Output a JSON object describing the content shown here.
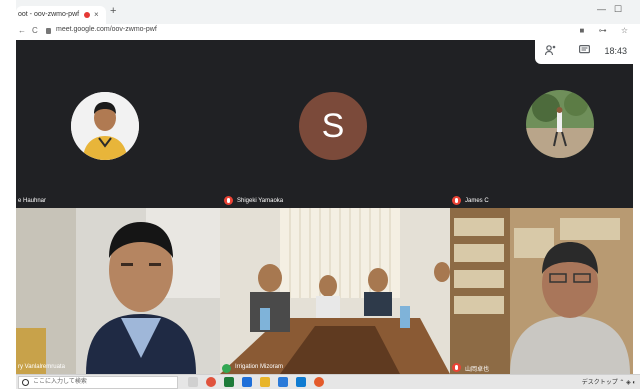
{
  "browser": {
    "tab_title": "oot - oov-zwmo-pwf",
    "url": "meet.google.com/oov-zwmo-pwf",
    "new_tab_glyph": "+",
    "close_glyph": "×",
    "back_glyph": "←",
    "forward_glyph": "→",
    "reload_glyph": "C"
  },
  "meet": {
    "time": "18:43",
    "people_icon": "people-icon",
    "chat_icon": "chat-icon",
    "participants": [
      {
        "name": "e Hauhnar",
        "type": "photo"
      },
      {
        "name": "Shigeki Yamaoka",
        "initial": "S",
        "type": "initial",
        "muted": true
      },
      {
        "name": "James C",
        "type": "photo",
        "muted": true
      },
      {
        "name": "ry Vanlalremruata",
        "type": "video"
      },
      {
        "name": "Irrigation Mizoram",
        "type": "video"
      },
      {
        "name": "山岡卓也",
        "type": "video",
        "muted": true
      }
    ]
  },
  "taskbar": {
    "search_placeholder": "ここに入力して検索",
    "tray_label": "デスクトップ"
  },
  "colors": {
    "meet_bg": "#202124",
    "avatar_s": "#7b4a3a",
    "mute_red": "#ea4335"
  }
}
